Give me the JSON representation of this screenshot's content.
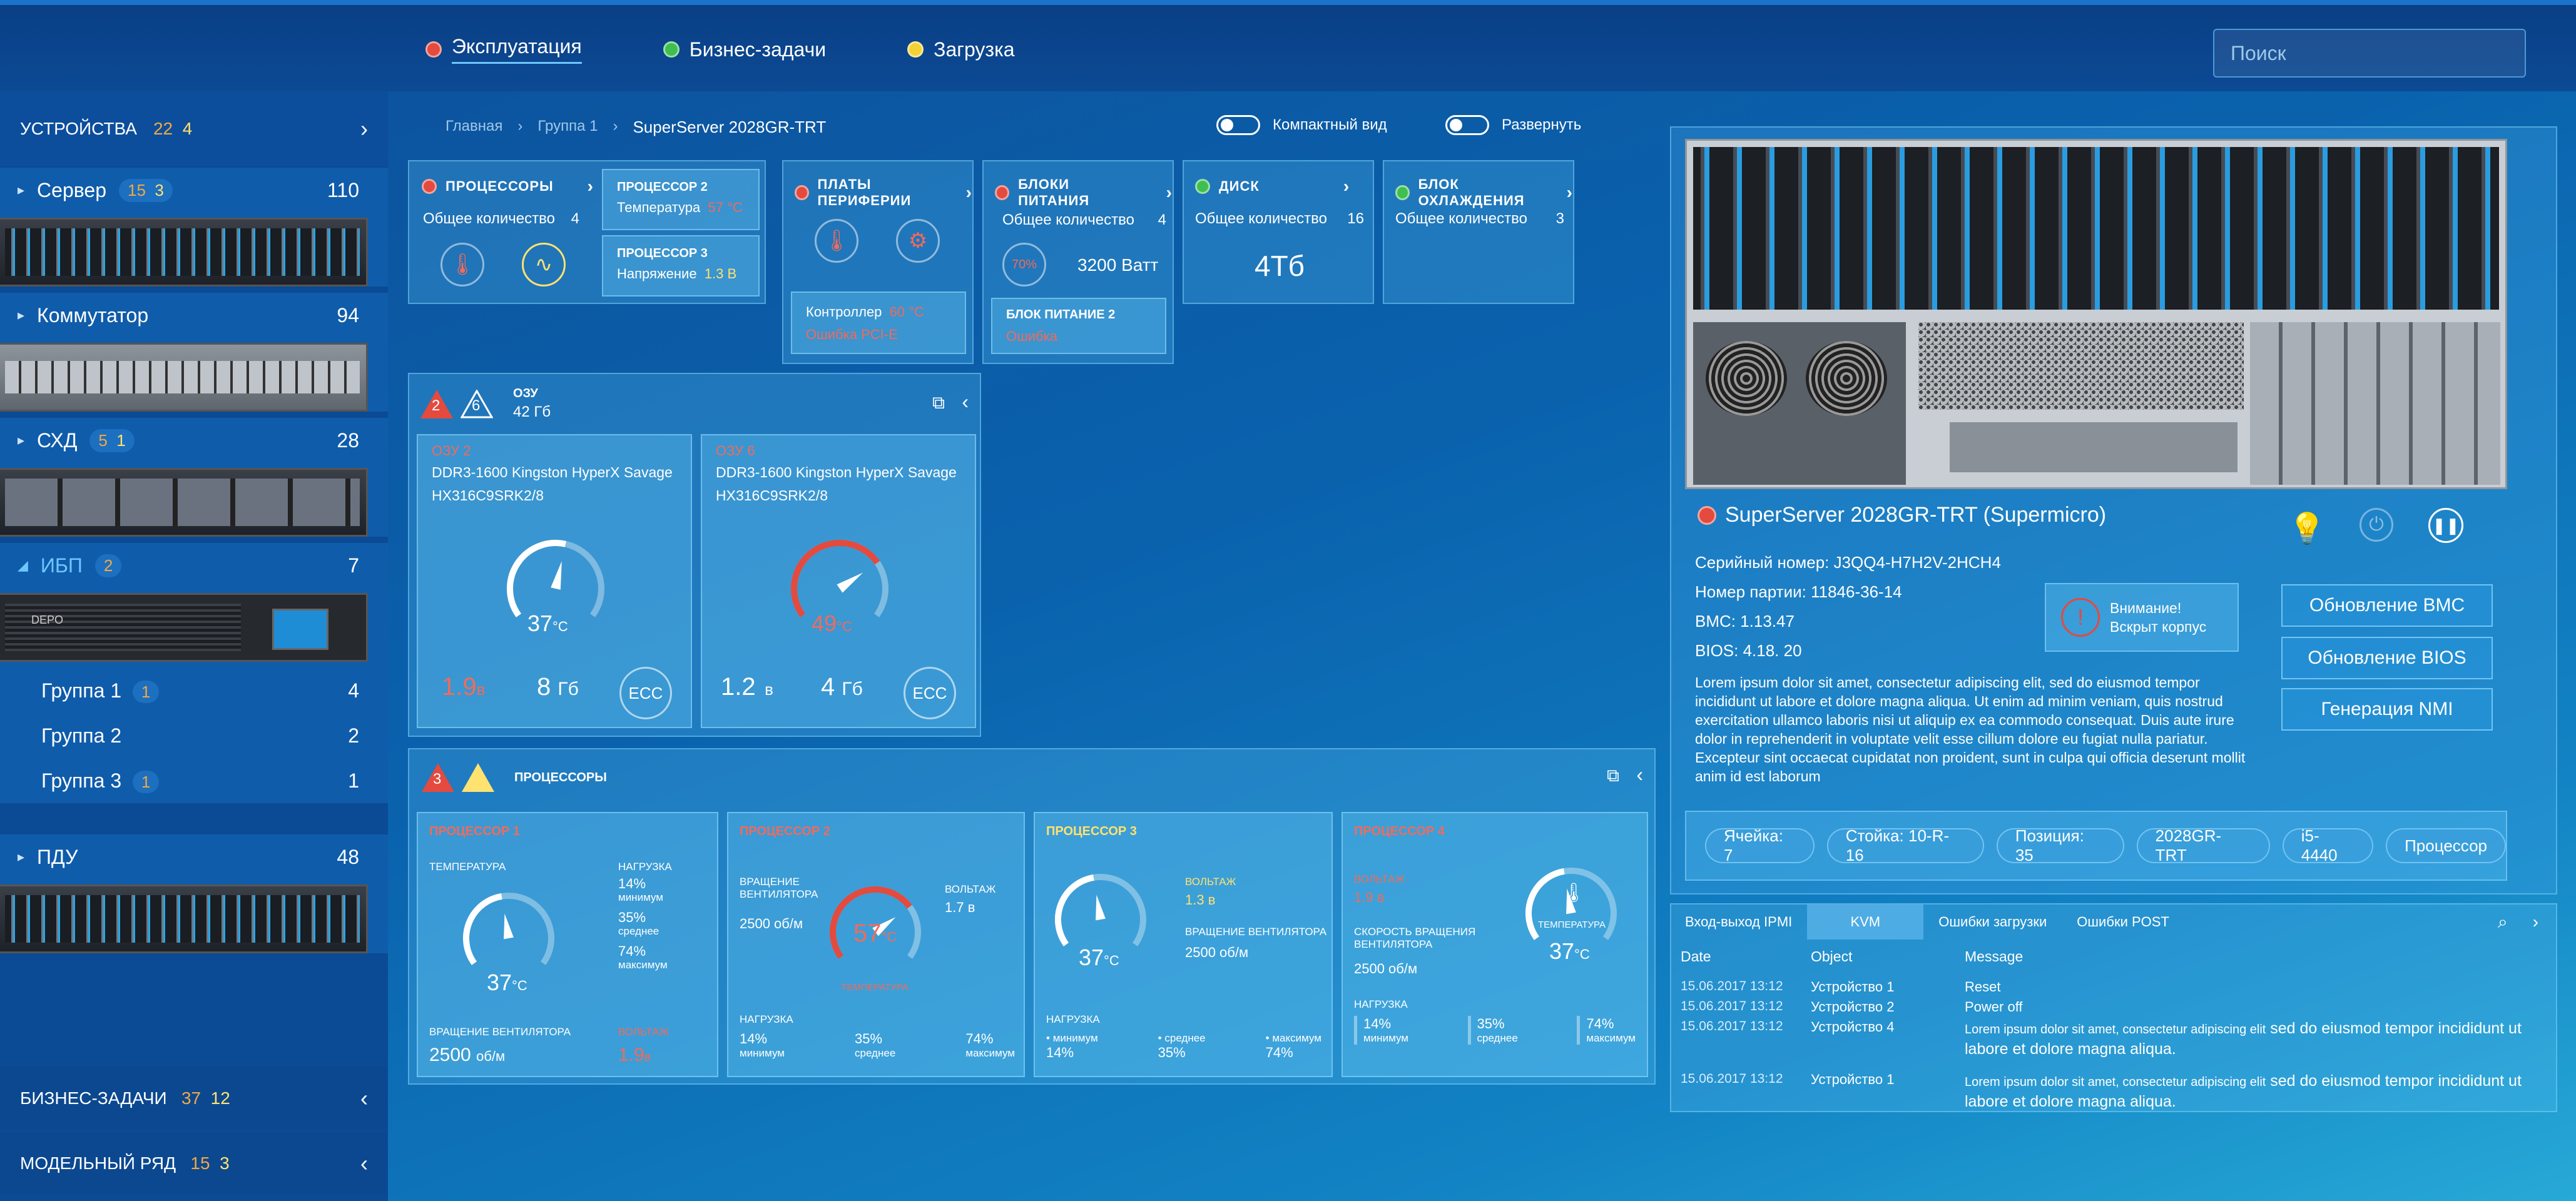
{
  "topnav": {
    "items": [
      {
        "label": "Эксплуатация",
        "dot": "#e44a3e"
      },
      {
        "label": "Бизнес-задачи",
        "dot": "#3fbf4f"
      },
      {
        "label": "Загрузка",
        "dot": "#f2d234"
      }
    ],
    "search_placeholder": "Поиск"
  },
  "sidebar": {
    "devices": {
      "label": "УСТРОЙСТВА",
      "c1": "22",
      "c2": "4"
    },
    "server": {
      "label": "Сервер",
      "c1": "15",
      "c2": "3",
      "total": "110"
    },
    "switch": {
      "label": "Коммутатор",
      "total": "94"
    },
    "sxd": {
      "label": "СХД",
      "c1": "5",
      "c2": "1",
      "total": "28"
    },
    "ibp": {
      "label": "ИБП",
      "c1": "2",
      "total": "7"
    },
    "groups": [
      {
        "label": "Группа 1",
        "badge": "1",
        "total": "4"
      },
      {
        "label": "Группа 2",
        "badge": "",
        "total": "2"
      },
      {
        "label": "Группа 3",
        "badge": "1",
        "total": "1"
      }
    ],
    "pdu": {
      "label": "ПДУ",
      "total": "48"
    },
    "business": {
      "label": "БИЗНЕС-ЗАДАЧИ",
      "c1": "37",
      "c2": "12"
    },
    "model": {
      "label": "МОДЕЛЬНЫЙ РЯД",
      "c1": "15",
      "c2": "3"
    },
    "ups_brand": "DEPO"
  },
  "breadcrumb": {
    "home": "Главная",
    "group": "Группа 1",
    "current": "SuperServer 2028GR-TRT"
  },
  "toggles": {
    "compact": "Компактный вид",
    "expand": "Развернуть"
  },
  "cards": {
    "cpu": {
      "title": "ПРОЦЕССОРЫ",
      "count_label": "Общее количество",
      "count": "4",
      "p2_title": "ПРОЦЕССОР 2",
      "p2_label": "Температура",
      "p2_value": "57 °C",
      "p3_title": "ПРОЦЕССОР 3",
      "p3_label": "Напряжение",
      "p3_value": "1.3 В"
    },
    "periph": {
      "title": "ПЛАТЫ ПЕРИФЕРИИ",
      "ctrl_label": "Контроллер",
      "ctrl_value": "60 °C",
      "ctrl_err": "Ошибка PCI-E"
    },
    "psu": {
      "title": "БЛОКИ ПИТАНИЯ",
      "count_label": "Общее количество",
      "count": "4",
      "power": "3200 Ватт",
      "ring": "70%",
      "b2_title": "БЛОК ПИТАНИЕ 2",
      "b2_err": "Ошибка"
    },
    "disk": {
      "title": "ДИСК",
      "count_label": "Общее количество",
      "count": "16",
      "size": "4Тб"
    },
    "cooling": {
      "title": "БЛОК ОХЛАЖДЕНИЯ",
      "count_label": "Общее количество",
      "count": "3"
    }
  },
  "ram": {
    "title": "ОЗУ",
    "size": "42 Гб",
    "err": "2",
    "warn": "6",
    "modules": [
      {
        "tag": "ОЗУ 2",
        "name": "DDR3-1600 Kingston HyperX Savage",
        "part": "HX316C9SRK2/8",
        "temp": "37",
        "unit": "°C",
        "volt": "1.9",
        "vunit": "в",
        "mem": "8",
        "munit": "Гб",
        "ecc": "ECC",
        "hot": false,
        "pct": 0.55
      },
      {
        "tag": "ОЗУ 6",
        "name": "DDR3-1600 Kingston HyperX Savage",
        "part": "HX316C9SRK2/8",
        "temp": "49",
        "unit": "°C",
        "volt": "1.2",
        "vunit": "в",
        "mem": "4",
        "munit": "Гб",
        "ecc": "ECC",
        "hot": true,
        "pct": 0.72
      }
    ]
  },
  "cpus": {
    "title": "ПРОЦЕССОРЫ",
    "err": "3",
    "p1": {
      "tag": "ПРОЦЕССОР 1",
      "temp_label": "ТЕМПЕРАТУРА",
      "temp": "37",
      "unit": "°C",
      "load_label": "НАГРУЗКА",
      "loads": [
        {
          "v": "14%",
          "l": "минимум"
        },
        {
          "v": "35%",
          "l": "среднее"
        },
        {
          "v": "74%",
          "l": "максимум"
        }
      ],
      "fan_label": "ВРАЩЕНИЕ ВЕНТИЛЯТОРА",
      "fan": "2500",
      "fan_unit": "об/м",
      "volt_label": "ВОЛЬТАЖ",
      "volt": "1.9",
      "vunit": "в"
    },
    "p2": {
      "tag": "ПРОЦЕССОР 2",
      "fan_label": "ВРАЩЕНИЕ ВЕНТИЛЯТОРА",
      "fan": "2500 об/м",
      "temp": "57",
      "unit": "°C",
      "temp_label": "ТЕМПЕРАТУРА",
      "volt_label": "ВОЛЬТАЖ",
      "volt": "1.7 в",
      "load_label": "НАГРУЗКА",
      "loads": [
        {
          "v": "14%",
          "l": "минимум"
        },
        {
          "v": "35%",
          "l": "среднее"
        },
        {
          "v": "74%",
          "l": "максимум"
        }
      ]
    },
    "p3": {
      "tag": "ПРОЦЕССОР 3",
      "temp": "37",
      "unit": "°C",
      "volt_label": "ВОЛЬТАЖ",
      "volt": "1.3 в",
      "fan_label": "ВРАЩЕНИЕ ВЕНТИЛЯТОРА",
      "fan": "2500 об/м",
      "load_label": "НАГРУЗКА",
      "loads": [
        {
          "v": "14%",
          "l": "минимум"
        },
        {
          "v": "35%",
          "l": "среднее"
        },
        {
          "v": "74%",
          "l": "максимум"
        }
      ]
    },
    "p4": {
      "tag": "ПРОЦЕССОР 4",
      "volt_label": "ВОЛЬТАЖ",
      "volt": "1.9 в",
      "fan_label": "СКОРОСТЬ ВРАЩЕНИЯ ВЕНТИЛЯТОРА",
      "fan": "2500 об/м",
      "temp_label": "ТЕМПЕРАТУРА",
      "temp": "37",
      "unit": "°C",
      "load_label": "НАГРУЗКА",
      "loads": [
        {
          "v": "14%",
          "l": "минимум"
        },
        {
          "v": "35%",
          "l": "среднее"
        },
        {
          "v": "74%",
          "l": "максимум"
        }
      ]
    }
  },
  "server": {
    "title": "SuperServer 2028GR-TRT (Supermicro)",
    "serial": "Серийный номер:  J3QQ4-H7H2V-2HCH4",
    "batch": "Номер партии: 11846-36-14",
    "bmc": "BMC: 1.13.47",
    "bios": "BIOS: 4.18. 20",
    "warning": "Внимание! Вскрыт корпус",
    "desc": "Lorem ipsum dolor sit amet, consectetur adipiscing elit, sed do eiusmod tempor incididunt ut labore et dolore magna aliqua. Ut enim ad minim veniam, quis nostrud exercitation ullamco laboris nisi ut aliquip ex ea commodo consequat. Duis aute irure dolor in reprehenderit in voluptate velit esse cillum dolore eu fugiat nulla pariatur. Excepteur sint occaecat cupidatat non proident, sunt in culpa qui officia deserunt mollit anim id est laborum",
    "buttons": [
      "Обновление BMC",
      "Обновление BIOS",
      "Генерация NMI"
    ],
    "chips": [
      "Ячейка: 7",
      "Стойка: 10-R-16",
      "Позиция: 35",
      "2028GR-TRT",
      "i5-4440",
      "Процессор"
    ]
  },
  "log": {
    "tabs": [
      "Вход-выход IPMI",
      "KVM",
      "Ошибки загрузки",
      "Ошибки POST"
    ],
    "headers": [
      "Date",
      "Object",
      "Message"
    ],
    "rows": [
      {
        "date": "15.06.2017",
        "time": "13:12",
        "obj": "Устройство 1",
        "msg": "Reset"
      },
      {
        "date": "15.06.2017",
        "time": "13:12",
        "obj": "Устройство 2",
        "msg": "Power off"
      },
      {
        "date": "15.06.2017",
        "time": "13:12",
        "obj": "Устройство 4",
        "msg_a": "Lorem ipsum dolor sit  amet,  consectetur  adipiscing elit",
        "msg_b": " sed do eiusmod tempor incididunt ut labore et dolore magna aliqua."
      },
      {
        "date": "15.06.2017",
        "time": "13:12",
        "obj": "Устройство 1",
        "msg_a": "Lorem ipsum dolor sit  amet,  consectetur  adipiscing elit",
        "msg_b": " sed do eiusmod tempor incididunt ut labore et dolore magna aliqua."
      }
    ]
  }
}
